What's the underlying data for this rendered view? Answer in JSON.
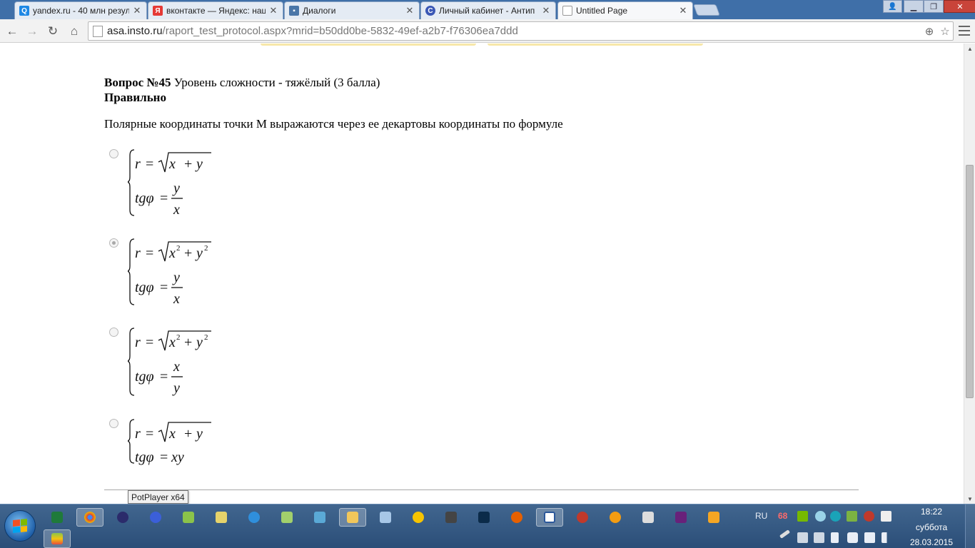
{
  "tabs": [
    {
      "title": "yandex.ru - 40 млн резул",
      "icon": "search-icon",
      "color": "#1e88e5"
    },
    {
      "title": "вконтакте — Яндекс: нац",
      "icon": "yandex-icon",
      "color": "#e53935"
    },
    {
      "title": "Диалоги",
      "icon": "chat-icon",
      "color": "#4a76a8"
    },
    {
      "title": "Личный кабинет - Антип",
      "icon": "c-logo-icon",
      "color": "#3a57b5"
    },
    {
      "title": "Untitled Page",
      "icon": "page-icon",
      "color": "#bbbbbb"
    }
  ],
  "address": {
    "host": "asa.insto.ru",
    "path": "/raport_test_protocol.aspx?mrid=b50dd0be-5832-49ef-a2b7-f76306ea7ddd"
  },
  "question": {
    "number_label": "Вопрос №45",
    "level": "Уровень сложности - тяжёлый (3 балла)",
    "status": "Правильно",
    "text": "Полярные координаты точки М выражаются через ее декартовы координаты по формуле"
  },
  "options": [
    {
      "checked": false,
      "r_rhs": "x + y",
      "squared": false,
      "tg_kind": "fraction",
      "num": "y",
      "den": "x"
    },
    {
      "checked": true,
      "r_rhs": "x² + y²",
      "squared": true,
      "tg_kind": "fraction",
      "num": "y",
      "den": "x"
    },
    {
      "checked": false,
      "r_rhs": "x² + y²",
      "squared": true,
      "tg_kind": "fraction",
      "num": "x",
      "den": "y"
    },
    {
      "checked": false,
      "r_rhs": "x + y",
      "squared": false,
      "tg_kind": "product",
      "prod": "xy"
    }
  ],
  "formula_labels": {
    "r": "r",
    "tg": "tgφ",
    "eq": "="
  },
  "tooltip": "PotPlayer x64",
  "tray": {
    "lang": "RU",
    "badge": "68"
  },
  "clock": {
    "time": "18:22",
    "day": "суббота",
    "date": "28.03.2015"
  }
}
